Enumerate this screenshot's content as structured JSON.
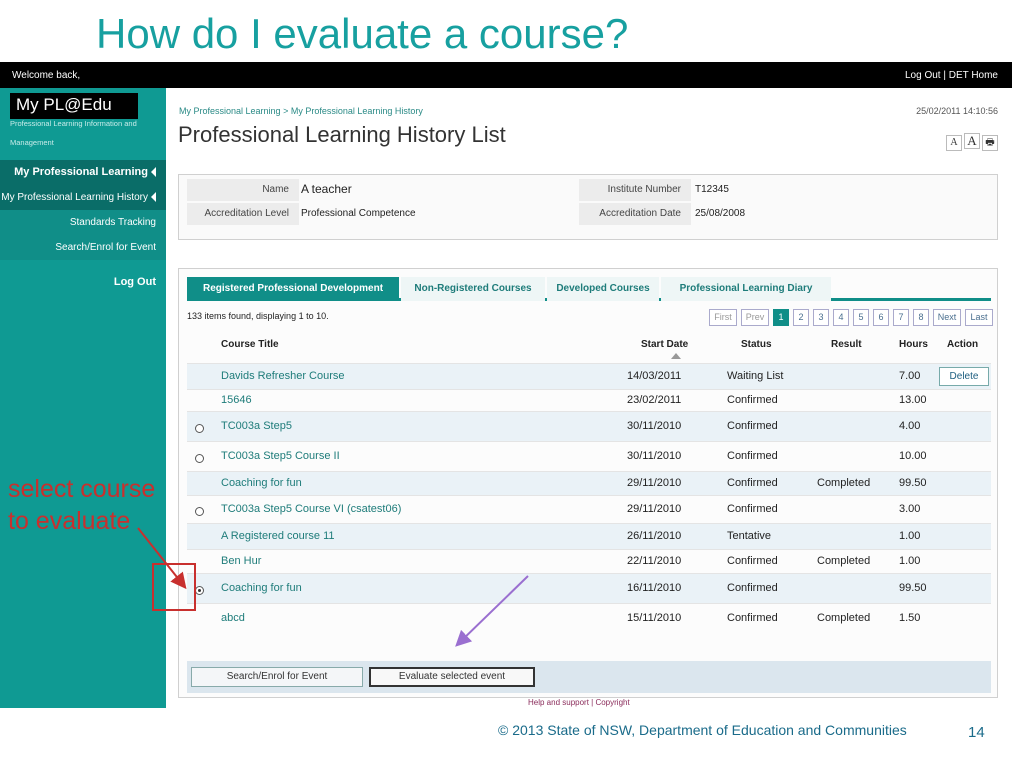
{
  "slide": {
    "title": "How do I evaluate a course?",
    "copyright": "© 2013 State of NSW, Department of Education and Communities",
    "number": "14",
    "annotation_line1": "select course",
    "annotation_line2": "to evaluate",
    "annotation_color": "#c8302e",
    "title_color": "#17a0a0"
  },
  "topbar": {
    "welcome": "Welcome back,",
    "links": "Log Out | DET Home"
  },
  "sidebar": {
    "brand": "My PL@Edu",
    "subtitle_line1": "Professional Learning Information and",
    "subtitle_line2": "Management",
    "accent_color": "#0f9a93",
    "items": [
      {
        "label": "My Professional Learning"
      },
      {
        "label": "My Professional Learning History"
      },
      {
        "label": "Standards Tracking"
      },
      {
        "label": "Search/Enrol for Event"
      },
      {
        "label": "Log Out"
      }
    ]
  },
  "main": {
    "breadcrumb_1": "My Professional Learning",
    "breadcrumb_sep": ">",
    "breadcrumb_2": "My Professional Learning History",
    "datetime": "25/02/2011 14:10:56",
    "title": "Professional Learning History List",
    "tools": {
      "small_a": "A",
      "big_a": "A",
      "print": "🖶"
    }
  },
  "info": {
    "name_label": "Name",
    "name_value": "A teacher",
    "accreditation_label": "Accreditation Level",
    "accreditation_value": "Professional Competence",
    "institute_label": "Institute Number",
    "institute_value": "T12345",
    "acc_date_label": "Accreditation Date",
    "acc_date_value": "25/08/2008"
  },
  "tabs": [
    {
      "label": "Registered Professional Development",
      "active": true
    },
    {
      "label": "Non-Registered Courses",
      "active": false
    },
    {
      "label": "Developed Courses",
      "active": false
    },
    {
      "label": "Professional Learning Diary",
      "active": false
    }
  ],
  "list": {
    "count_text": "133 items found, displaying 1 to 10.",
    "pager": [
      "First",
      "Prev",
      "1",
      "2",
      "3",
      "4",
      "5",
      "6",
      "7",
      "8",
      "Next",
      "Last"
    ],
    "current_page": "1",
    "columns": {
      "course_title": "Course Title",
      "start_date": "Start Date",
      "status": "Status",
      "result": "Result",
      "hours": "Hours",
      "action": "Action"
    },
    "rows": [
      {
        "radio": "none",
        "title": "Davids Refresher Course",
        "start": "14/03/2011",
        "status": "Waiting List",
        "result": "",
        "hours": "7.00",
        "action": "Delete"
      },
      {
        "radio": "none",
        "title": "15646",
        "start": "23/02/2011",
        "status": "Confirmed",
        "result": "",
        "hours": "13.00",
        "action": ""
      },
      {
        "radio": "empty",
        "title": "TC003a Step5",
        "start": "30/11/2010",
        "status": "Confirmed",
        "result": "",
        "hours": "4.00",
        "action": ""
      },
      {
        "radio": "empty",
        "title": "TC003a Step5 Course II",
        "start": "30/11/2010",
        "status": "Confirmed",
        "result": "",
        "hours": "10.00",
        "action": ""
      },
      {
        "radio": "none",
        "title": "Coaching for fun",
        "start": "29/11/2010",
        "status": "Confirmed",
        "result": "Completed",
        "hours": "99.50",
        "action": ""
      },
      {
        "radio": "empty",
        "title": "TC003a Step5 Course VI (csatest06)",
        "start": "29/11/2010",
        "status": "Confirmed",
        "result": "",
        "hours": "3.00",
        "action": ""
      },
      {
        "radio": "none",
        "title": "A Registered course 11",
        "start": "26/11/2010",
        "status": "Tentative",
        "result": "",
        "hours": "1.00",
        "action": ""
      },
      {
        "radio": "none",
        "title": "Ben Hur",
        "start": "22/11/2010",
        "status": "Confirmed",
        "result": "Completed",
        "hours": "1.00",
        "action": ""
      },
      {
        "radio": "checked",
        "title": "Coaching for fun",
        "start": "16/11/2010",
        "status": "Confirmed",
        "result": "",
        "hours": "99.50",
        "action": ""
      },
      {
        "radio": "none",
        "title": "abcd",
        "start": "15/11/2010",
        "status": "Confirmed",
        "result": "Completed",
        "hours": "1.50",
        "action": ""
      }
    ]
  },
  "buttons": {
    "search": "Search/Enrol for Event",
    "evaluate": "Evaluate selected event"
  },
  "help_text": "Help and support | Copyright"
}
